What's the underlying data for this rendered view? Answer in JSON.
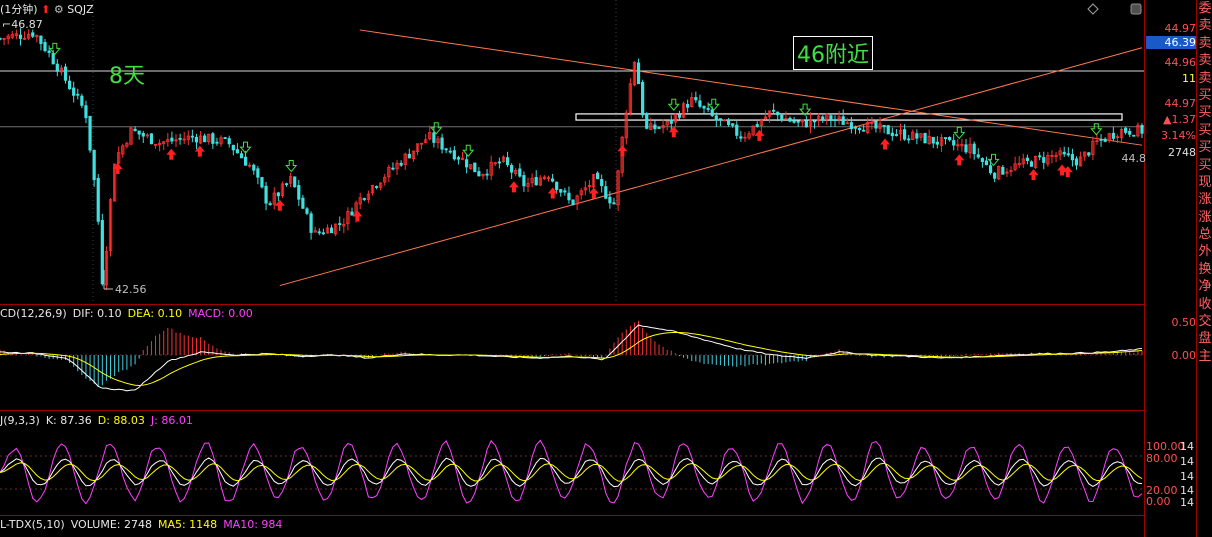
{
  "header": {
    "period": "(1分钟)",
    "symbol": "SQJZ",
    "high_label": "46.87",
    "low_label": "42.56"
  },
  "price_axis": {
    "labels": [
      "44.97",
      "46.39",
      "44.96",
      "11",
      "44.97",
      "▲1.37",
      "3.14%",
      "2748",
      "44.8"
    ]
  },
  "annotations": {
    "days": "8天",
    "near46": "46附近"
  },
  "side_panel": [
    "委",
    "卖",
    "卖",
    "卖",
    "卖",
    "买",
    "买",
    "买",
    "买",
    "买",
    "现",
    "涨",
    "涨",
    "总",
    "外",
    "换",
    "净",
    "收",
    "交",
    "盘",
    "主"
  ],
  "macd": {
    "name": "CD(12,26,9)",
    "dif": "DIF: 0.10",
    "dea": "DEA: 0.10",
    "macd": "MACD: 0.00",
    "axis": [
      "0.50",
      "0.00"
    ]
  },
  "kdj": {
    "name": "J(9,3,3)",
    "k": "K: 87.36",
    "d": "D: 88.03",
    "j": "J: 86.01",
    "axis": [
      "100.00",
      "80.00",
      "20.00",
      "0.00"
    ],
    "right_digits": [
      "14",
      "14",
      "14",
      "14",
      "14"
    ]
  },
  "volume": {
    "name": "L-TDX(5,10)",
    "volume": "VOLUME: 2748",
    "ma5": "MA5: 1148",
    "ma10": "MA10: 984"
  },
  "chart_data": {
    "type": "candlestick",
    "title": "",
    "ylim": [
      42.4,
      47.0
    ],
    "hlines": [
      46.07,
      45.16
    ],
    "resistance_box": [
      45.27,
      45.37
    ],
    "trendline_down": {
      "from": [
        0.315,
        46.74
      ],
      "to": [
        1.0,
        44.86
      ]
    },
    "trendline_up": {
      "from": [
        0.245,
        42.57
      ],
      "to": [
        1.0,
        46.45
      ]
    },
    "ohlc_keypoints": [
      [
        0.0,
        46.6
      ],
      [
        0.03,
        46.7
      ],
      [
        0.045,
        46.3
      ],
      [
        0.075,
        45.4
      ],
      [
        0.085,
        43.9
      ],
      [
        0.09,
        42.56
      ],
      [
        0.1,
        44.6
      ],
      [
        0.115,
        45.1
      ],
      [
        0.14,
        44.9
      ],
      [
        0.17,
        45.0
      ],
      [
        0.2,
        44.9
      ],
      [
        0.22,
        44.5
      ],
      [
        0.235,
        43.9
      ],
      [
        0.255,
        44.3
      ],
      [
        0.275,
        43.4
      ],
      [
        0.3,
        43.6
      ],
      [
        0.32,
        44.1
      ],
      [
        0.345,
        44.5
      ],
      [
        0.375,
        45.0
      ],
      [
        0.4,
        44.7
      ],
      [
        0.42,
        44.4
      ],
      [
        0.44,
        44.6
      ],
      [
        0.46,
        44.2
      ],
      [
        0.48,
        44.4
      ],
      [
        0.5,
        43.9
      ],
      [
        0.52,
        44.3
      ],
      [
        0.538,
        43.9
      ],
      [
        0.547,
        45.3
      ],
      [
        0.556,
        46.3
      ],
      [
        0.565,
        45.1
      ],
      [
        0.585,
        45.2
      ],
      [
        0.605,
        45.6
      ],
      [
        0.625,
        45.3
      ],
      [
        0.65,
        45.0
      ],
      [
        0.675,
        45.4
      ],
      [
        0.7,
        45.2
      ],
      [
        0.725,
        45.3
      ],
      [
        0.75,
        45.2
      ],
      [
        0.775,
        45.1
      ],
      [
        0.8,
        45.0
      ],
      [
        0.825,
        44.9
      ],
      [
        0.85,
        44.8
      ],
      [
        0.87,
        44.4
      ],
      [
        0.885,
        44.5
      ],
      [
        0.905,
        44.6
      ],
      [
        0.925,
        44.7
      ],
      [
        0.945,
        44.6
      ],
      [
        0.96,
        44.9
      ],
      [
        0.98,
        45.1
      ],
      [
        1.0,
        45.1
      ]
    ],
    "macd_dif": [
      0.05,
      0.03,
      -0.05,
      -0.55,
      -0.6,
      -0.1,
      0.05,
      0.0,
      0.02,
      -0.02,
      0.0,
      -0.05,
      0.02,
      0.0,
      0.0,
      -0.03,
      -0.05,
      -0.02,
      -0.08,
      0.5,
      0.4,
      0.25,
      0.1,
      0.0,
      -0.05,
      0.05,
      0.0,
      -0.02,
      -0.05,
      -0.03,
      0.0,
      0.02,
      0.03,
      0.05,
      0.1
    ],
    "kdj_period": 9
  }
}
